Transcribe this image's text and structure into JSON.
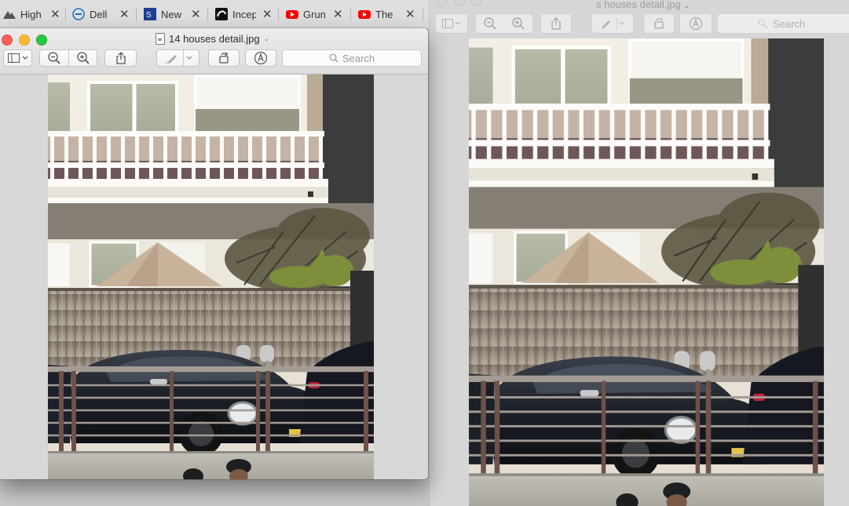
{
  "browser_tabs": [
    {
      "title": "High",
      "icon": "mountain-icon",
      "close": "✕"
    },
    {
      "title": "Dell",
      "icon": "dell-logo-icon",
      "close": "✕"
    },
    {
      "title": "New",
      "icon": "news-logo-icon",
      "close": "✕"
    },
    {
      "title": "Incep",
      "icon": "app-logo-icon",
      "close": "✕"
    },
    {
      "title": "Grun",
      "icon": "youtube-icon",
      "close": "✕"
    },
    {
      "title": "The",
      "icon": "youtube-icon",
      "close": "✕"
    }
  ],
  "front_window": {
    "title": "14 houses detail.jpg",
    "title_chevron": "⌄",
    "search_placeholder": "Search"
  },
  "back_window": {
    "title": "s houses detail.jpg",
    "title_chevron": "⌄",
    "search_placeholder": "Search"
  },
  "colors": {
    "accent_close": "#fc5f57",
    "accent_min": "#fdbc2e",
    "accent_max": "#28c840",
    "youtube_red": "#ff0000"
  }
}
